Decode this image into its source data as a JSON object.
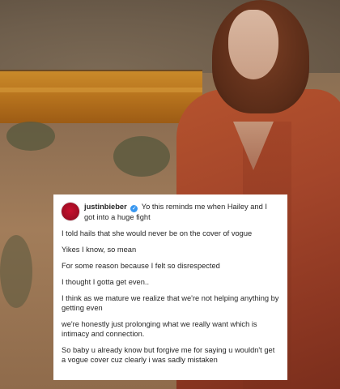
{
  "post": {
    "username": "justinbieber",
    "caption_first": "Yo this reminds me when Hailey and I got into a huge fight",
    "paragraphs": [
      "I told hails that she would never be on the cover of vogue",
      "Yikes I know, so mean",
      "For some reason because I felt so disrespected",
      "I thought I gotta get even..",
      "I think as we mature we realize that we're not helping anything by getting even",
      "we're honestly just prolonging what we really want which is intimacy and connection.",
      "So baby u already know but forgive me for saying u wouldn't get a vogue cover cuz clearly i was sadly mistaken"
    ]
  },
  "icons": {
    "verified": "verified-badge-icon",
    "avatar": "profile-avatar"
  },
  "colors": {
    "verified": "#3897f0",
    "avatar": "#c8102e",
    "coat": "#a3452a"
  }
}
